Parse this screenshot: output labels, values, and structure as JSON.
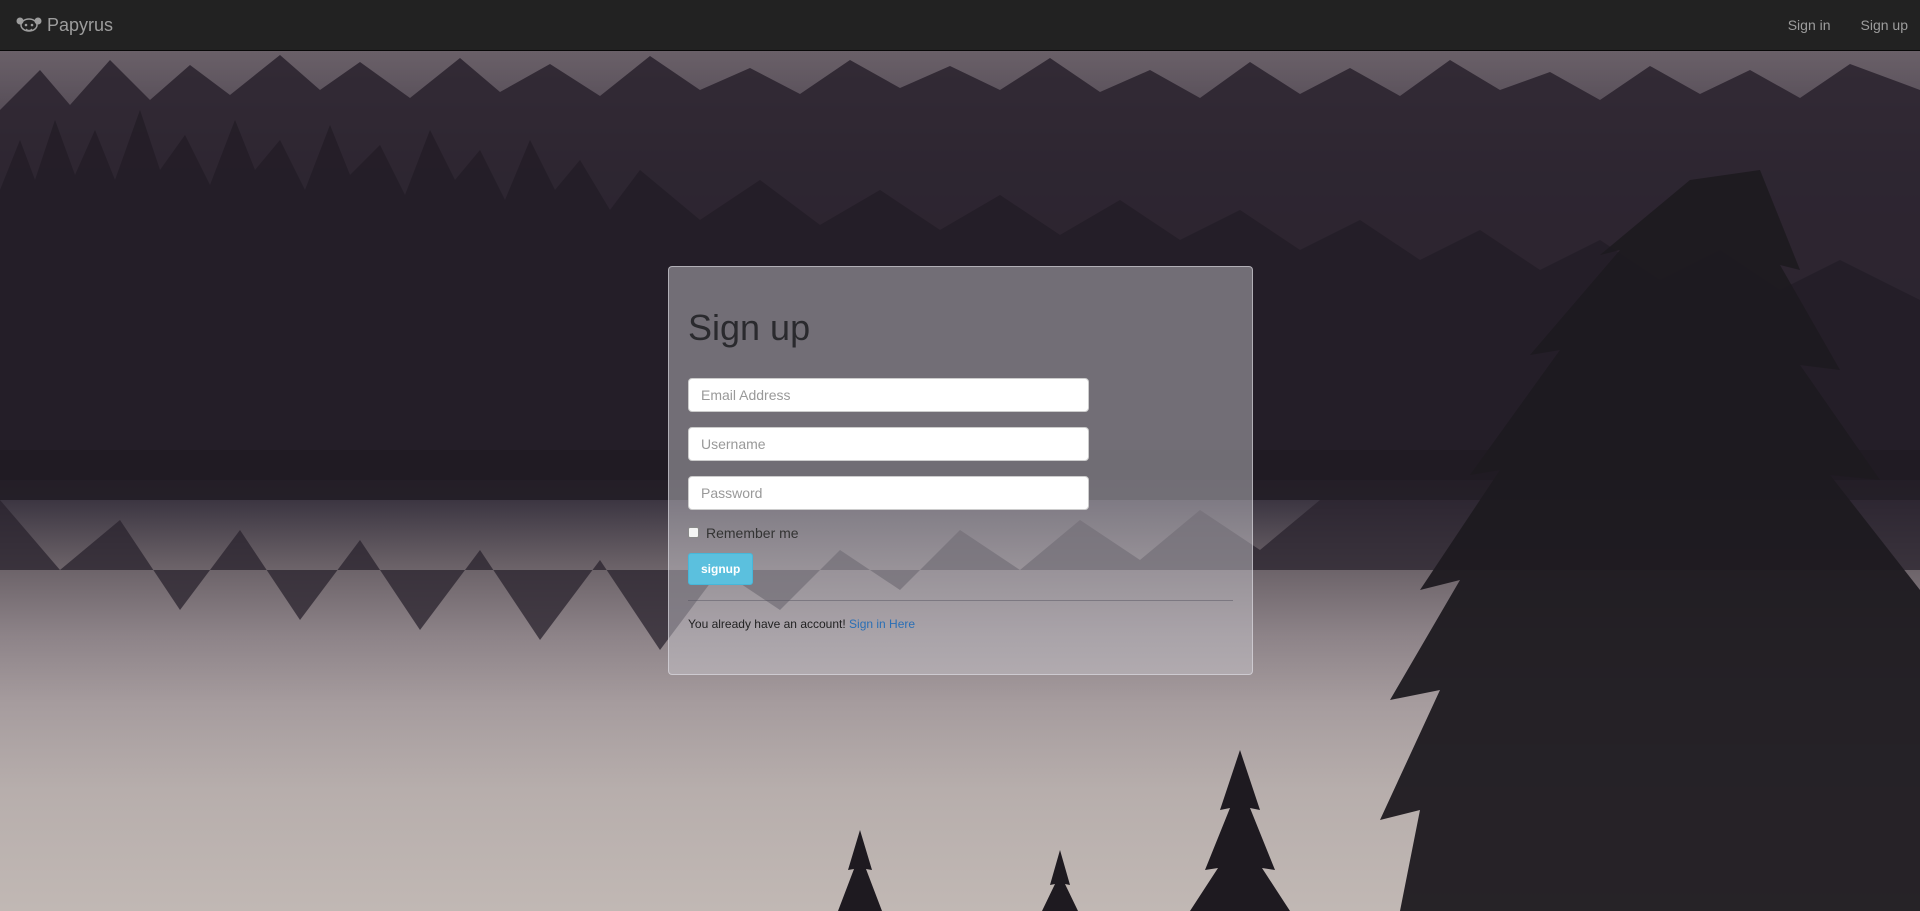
{
  "navbar": {
    "brand": "Papyrus",
    "logo_icon": "papyrus-logo-icon",
    "links": [
      {
        "label": "Sign in"
      },
      {
        "label": "Sign up"
      }
    ]
  },
  "form": {
    "title": "Sign up",
    "email_placeholder": "Email Address",
    "username_placeholder": "Username",
    "password_placeholder": "Password",
    "remember_label": "Remember me",
    "remember_checked": false,
    "submit_label": "signup",
    "footer_text": "You already have an account!",
    "footer_link": "Sign in Here"
  },
  "colors": {
    "navbar_bg": "#222222",
    "button": "#5bc0de",
    "link": "#2a6fb5"
  }
}
